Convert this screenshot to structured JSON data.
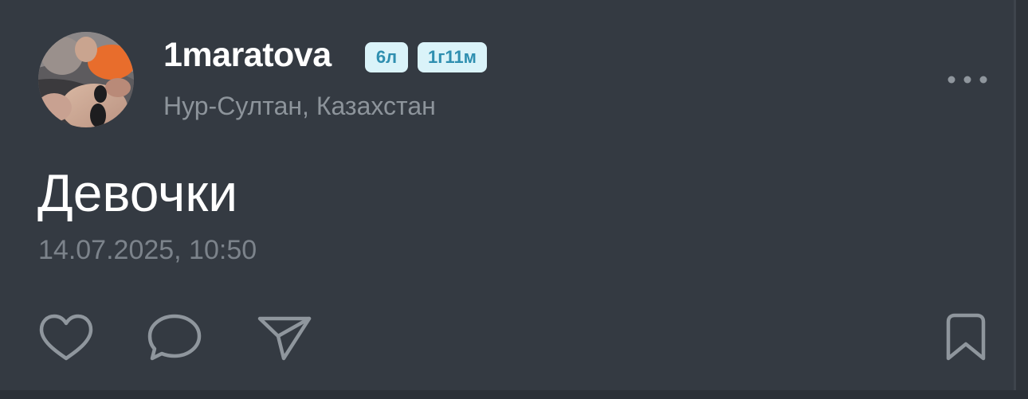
{
  "post": {
    "username": "1maratova",
    "badges": [
      "6л",
      "1г11м"
    ],
    "location": "Нур-Султан, Казахстан",
    "text": "Девочки",
    "timestamp": "14.07.2025, 10:50"
  },
  "icons": {
    "avatar": "avatar-photo",
    "more": "more-horizontal-icon",
    "like": "heart-icon",
    "comment": "comment-bubble-icon",
    "share": "paper-plane-icon",
    "bookmark": "bookmark-icon"
  },
  "colors": {
    "background": "#343a42",
    "badge_bg": "#daf3f9",
    "badge_text": "#2f8fb0",
    "secondary_text": "#8d949b",
    "icon": "#8f969d"
  }
}
